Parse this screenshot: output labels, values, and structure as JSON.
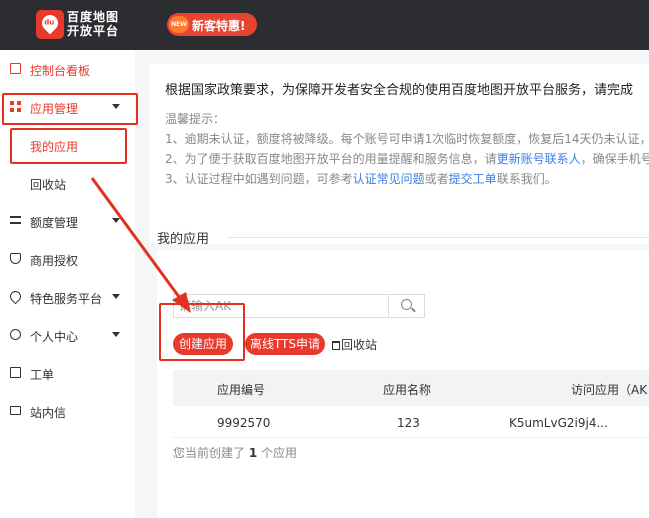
{
  "header": {
    "logo_badge": "du",
    "logo_line1": "百度地图",
    "logo_line2": "开放平台",
    "promo_badge": "NEW",
    "promo_text": "新客特惠!"
  },
  "sidebar": {
    "items": [
      {
        "label": "控制台看板",
        "icon": "dashboard-icon"
      },
      {
        "label": "应用管理",
        "icon": "apps-grid-icon"
      },
      {
        "label": "我的应用"
      },
      {
        "label": "回收站"
      },
      {
        "label": "额度管理",
        "icon": "quota-slider-icon"
      },
      {
        "label": "商用授权",
        "icon": "shield-icon"
      },
      {
        "label": "特色服务平台",
        "icon": "heart-icon"
      },
      {
        "label": "个人中心",
        "icon": "user-icon"
      },
      {
        "label": "工单",
        "icon": "ticket-icon"
      },
      {
        "label": "站内信",
        "icon": "mail-icon"
      }
    ]
  },
  "notice": {
    "main": "根据国家政策要求，为保障开发者安全合规的使用百度地图开放平台服务，请完成",
    "tips_title": "温馨提示：",
    "tip1": "1、逾期未认证，额度将被降级。每个账号可申请1次临时恢复额度，恢复后14天仍未认证，",
    "tip2_pre": "2、为了便于获取百度地图开放平台的用量提醒和服务信息，请",
    "tip2_link": "更新账号联系人",
    "tip2_post": "，确保手机号",
    "tip3_pre": "3、认证过程中如遇到问题，可参考",
    "tip3_link1": "认证常见问题",
    "tip3_mid": "或者",
    "tip3_link2": "提交工单",
    "tip3_post": "联系我们。"
  },
  "section_title": "我的应用",
  "search": {
    "placeholder": "请输入AK",
    "value": ""
  },
  "actions": {
    "create_app": "创建应用",
    "offline_tts": "离线TTS申请",
    "recycle_bin": "回收站"
  },
  "table": {
    "headers": [
      "应用编号",
      "应用名称",
      "访问应用（AK"
    ],
    "rows": [
      [
        "9992570",
        "123",
        "K5umLvG2i9j4..."
      ]
    ]
  },
  "summary": {
    "pre": "您当前创建了",
    "count": "1",
    "post": "个应用"
  },
  "colors": {
    "accent": "#e8392d",
    "topbar": "#2b2d31",
    "link": "#3a7ee6"
  }
}
